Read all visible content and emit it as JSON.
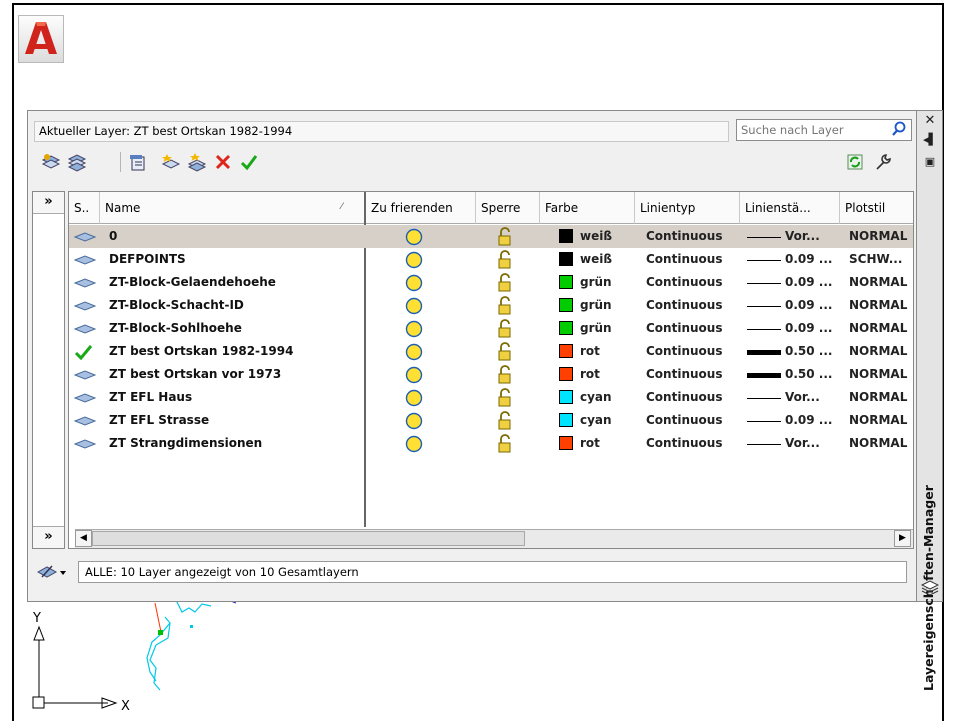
{
  "palette": {
    "title": "Layereigenschaften-Manager",
    "current_layer": "Aktueller Layer: ZT best Ortskan 1982-1994",
    "search_placeholder": "Suche nach Layer",
    "status": "ALLE: 10 Layer angezeigt von 10 Gesamtlayern"
  },
  "columns": [
    "S..",
    "Name",
    "Zu frierenden",
    "Sperre",
    "Farbe",
    "Linientyp",
    "Linienstä...",
    "Plotstil"
  ],
  "layers": [
    {
      "name": "0",
      "color": "weiß",
      "swatch": "#000000",
      "linetype": "Continuous",
      "lineweight": "Vor...",
      "heavy": false,
      "plotstyle": "NORMAL",
      "current": false,
      "selected": true
    },
    {
      "name": "DEFPOINTS",
      "color": "weiß",
      "swatch": "#000000",
      "linetype": "Continuous",
      "lineweight": "0.09 ...",
      "heavy": false,
      "plotstyle": "SCHW...",
      "current": false,
      "selected": false
    },
    {
      "name": "ZT-Block-Gelaendehoehe",
      "color": "grün",
      "swatch": "#00cc00",
      "linetype": "Continuous",
      "lineweight": "0.09 ...",
      "heavy": false,
      "plotstyle": "NORMAL",
      "current": false,
      "selected": false
    },
    {
      "name": "ZT-Block-Schacht-ID",
      "color": "grün",
      "swatch": "#00cc00",
      "linetype": "Continuous",
      "lineweight": "0.09 ...",
      "heavy": false,
      "plotstyle": "NORMAL",
      "current": false,
      "selected": false
    },
    {
      "name": "ZT-Block-Sohlhoehe",
      "color": "grün",
      "swatch": "#00cc00",
      "linetype": "Continuous",
      "lineweight": "0.09 ...",
      "heavy": false,
      "plotstyle": "NORMAL",
      "current": false,
      "selected": false
    },
    {
      "name": "ZT best Ortskan 1982-1994",
      "color": "rot",
      "swatch": "#ff4000",
      "linetype": "Continuous",
      "lineweight": "0.50 ...",
      "heavy": true,
      "plotstyle": "NORMAL",
      "current": true,
      "selected": false
    },
    {
      "name": "ZT best Ortskan vor 1973",
      "color": "rot",
      "swatch": "#ff4000",
      "linetype": "Continuous",
      "lineweight": "0.50 ...",
      "heavy": true,
      "plotstyle": "NORMAL",
      "current": false,
      "selected": false
    },
    {
      "name": "ZT EFL Haus",
      "color": "cyan",
      "swatch": "#00e5ff",
      "linetype": "Continuous",
      "lineweight": "Vor...",
      "heavy": false,
      "plotstyle": "NORMAL",
      "current": false,
      "selected": false
    },
    {
      "name": "ZT EFL Strasse",
      "color": "cyan",
      "swatch": "#00e5ff",
      "linetype": "Continuous",
      "lineweight": "0.09 ...",
      "heavy": false,
      "plotstyle": "NORMAL",
      "current": false,
      "selected": false
    },
    {
      "name": "ZT Strangdimensionen",
      "color": "rot",
      "swatch": "#ff4000",
      "linetype": "Continuous",
      "lineweight": "Vor...",
      "heavy": false,
      "plotstyle": "NORMAL",
      "current": false,
      "selected": false
    }
  ],
  "drawing": {
    "axis_y": "Y",
    "axis_x": "X"
  },
  "icons": {
    "app": "autocad-logo-icon",
    "toolbar": [
      "new-property-filter-icon",
      "new-group-filter-icon",
      "layer-states-manager-icon",
      "new-layer-icon",
      "new-layer-vp-frozen-icon",
      "delete-layer-icon",
      "set-current-icon"
    ],
    "right": [
      "refresh-icon",
      "settings-wrench-icon"
    ]
  }
}
